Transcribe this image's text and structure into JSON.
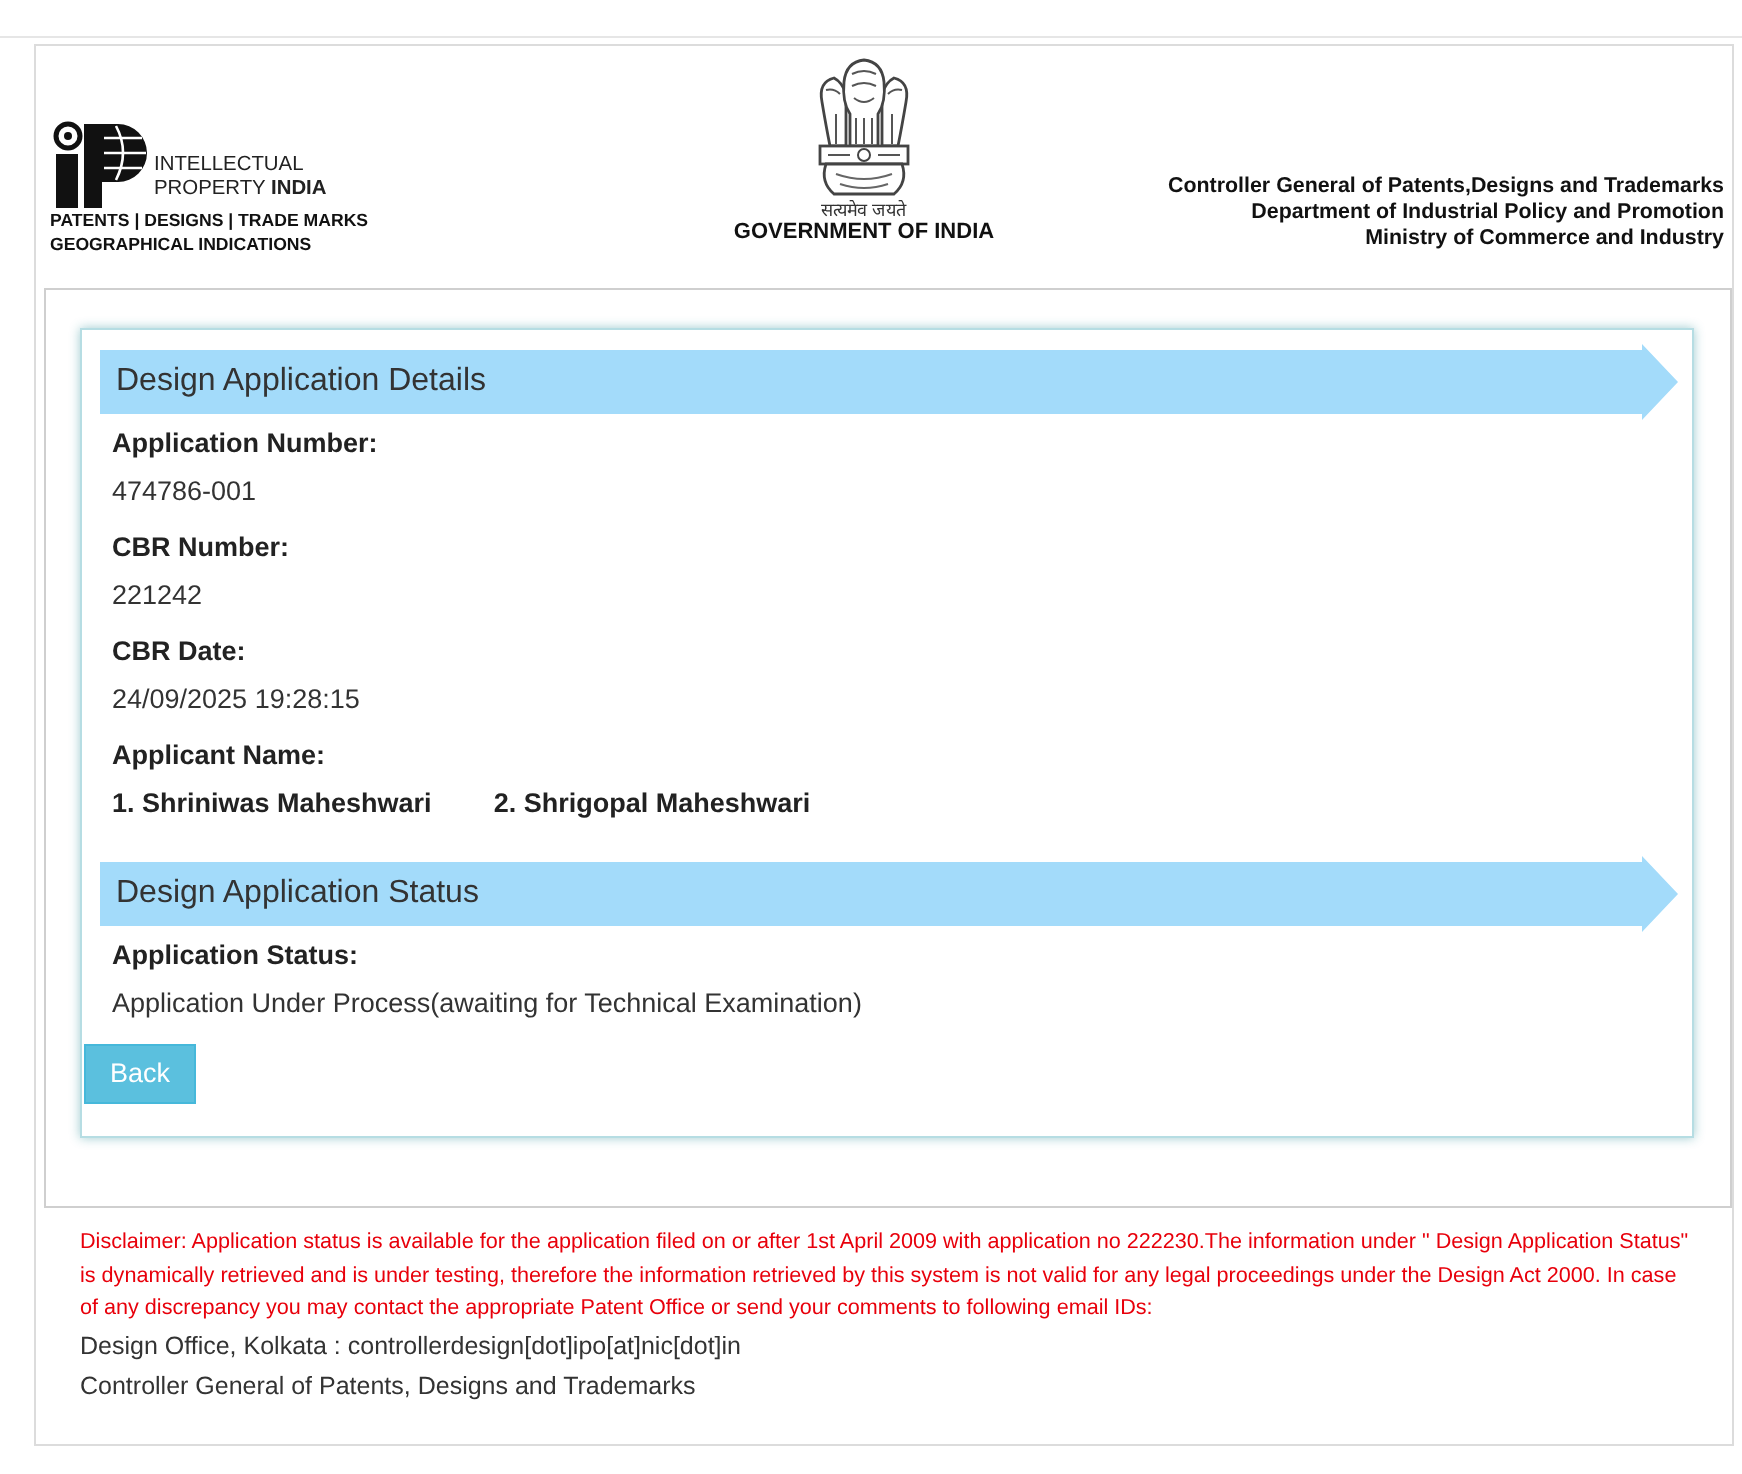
{
  "header": {
    "logo": {
      "lines": [
        "INTELLECTUAL",
        "PROPERTY **INDIA**"
      ],
      "tagline_lines": [
        "PATENTS | DESIGNS | TRADE MARKS",
        "GEOGRAPHICAL INDICATIONS"
      ]
    },
    "emblem": {
      "motto": "सत्यमेव जयते",
      "caption": "GOVERNMENT OF INDIA"
    },
    "office_lines": [
      "Controller General of Patents,Designs and Trademarks",
      "Department of Industrial Policy and Promotion",
      "Ministry of Commerce and Industry"
    ]
  },
  "sections": [
    {
      "title": "Design Application Details",
      "fields": [
        {
          "kind": "plain",
          "label": "Application Number:",
          "values": [
            "474786-001"
          ]
        },
        {
          "kind": "plain",
          "label": "CBR Number:",
          "values": [
            "221242"
          ]
        },
        {
          "kind": "plain",
          "label": "CBR Date:",
          "values": [
            "24/09/2025 19:28:15"
          ]
        },
        {
          "kind": "names",
          "label": "Applicant Name:",
          "values": [
            "1. Shriniwas Maheshwari",
            "2. Shrigopal Maheshwari"
          ]
        }
      ]
    },
    {
      "title": "Design Application Status",
      "fields": [
        {
          "kind": "plain",
          "label": "Application Status:",
          "values": [
            "Application Under Process(awaiting for Technical Examination)"
          ]
        }
      ]
    }
  ],
  "back_button": {
    "label": "Back"
  },
  "disclaimer": "Disclaimer: Application status is available for the application filed on or after 1st April 2009 with application no 222230.The information under \" Design Application Status\" is dynamically retrieved and is under testing, therefore the information retrieved by this system is not valid for any legal proceedings under the Design Act 2000. In case of any discrepancy you may contact the appropriate Patent Office or send your comments to following email IDs:",
  "contacts": [
    "Design Office, Kolkata : controllerdesign[dot]ipo[at]nic[dot]in",
    "Controller General of Patents, Designs and Trademarks"
  ]
}
